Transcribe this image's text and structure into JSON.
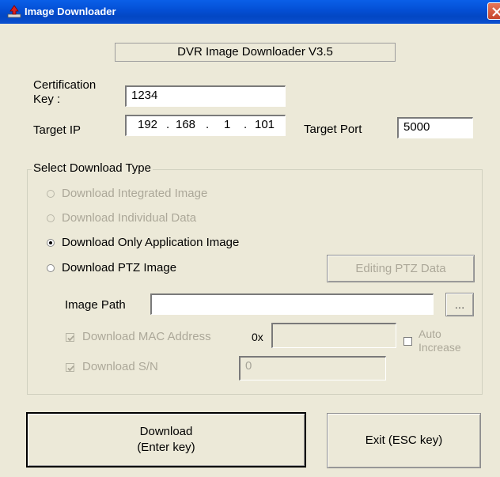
{
  "window": {
    "title": "Image Downloader",
    "header": "DVR Image Downloader V3.5"
  },
  "form": {
    "cert_key_label_line1": "Certification",
    "cert_key_label_line2": "Key :",
    "cert_key_value": "1234",
    "target_ip_label": "Target IP",
    "ip_octets": [
      "192",
      "168",
      "1",
      "101"
    ],
    "ip_separator": ".",
    "target_port_label": "Target Port",
    "target_port_value": "5000"
  },
  "download_type": {
    "group_title": "Select Download Type",
    "options": [
      {
        "label": "Download Integrated Image",
        "enabled": false,
        "selected": false
      },
      {
        "label": "Download Individual Data",
        "enabled": false,
        "selected": false
      },
      {
        "label": "Download Only Application Image",
        "enabled": true,
        "selected": true
      },
      {
        "label": "Download PTZ Image",
        "enabled": true,
        "selected": false
      }
    ],
    "editing_ptz_label": "Editing PTZ Data",
    "image_path_label": "Image Path",
    "image_path_value": "",
    "browse_label": "...",
    "mac_label": "Download MAC Address",
    "mac_checked": true,
    "mac_prefix": "0x",
    "mac_value": "",
    "auto_increase_line1": "Auto",
    "auto_increase_line2": "Increase",
    "auto_increase_checked": false,
    "sn_label": "Download S/N",
    "sn_checked": true,
    "sn_value": "0"
  },
  "buttons": {
    "download_line1": "Download",
    "download_line2": "(Enter key)",
    "exit": "Exit (ESC key)"
  },
  "icons": {
    "app": "downloader-app-icon",
    "close": "close-icon",
    "check": "checkmark-icon"
  }
}
